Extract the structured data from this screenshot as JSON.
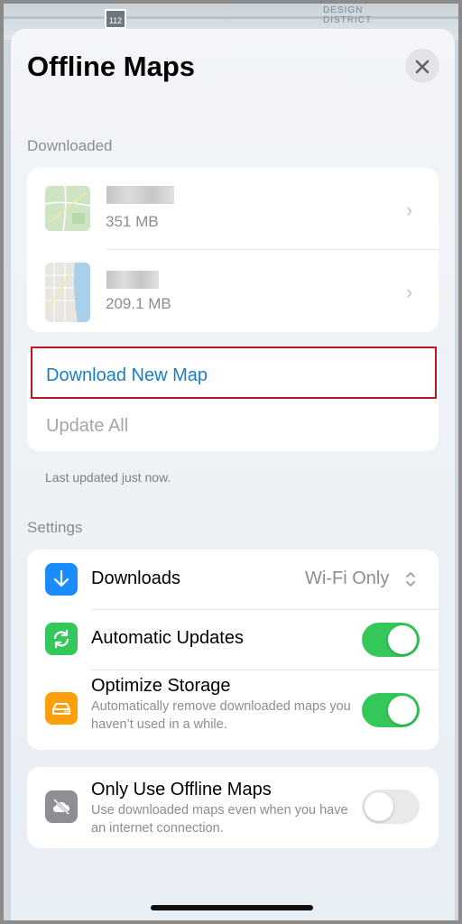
{
  "header": {
    "title": "Offline Maps",
    "close_icon": "close-icon"
  },
  "background_map": {
    "route_number": "112",
    "district_label": "DESIGN\nDISTRICT"
  },
  "downloaded": {
    "section_label": "Downloaded",
    "maps": [
      {
        "name_redacted": true,
        "size": "351 MB"
      },
      {
        "name_redacted": true,
        "size": "209.1 MB"
      }
    ]
  },
  "actions": {
    "download_new_map": "Download New Map",
    "update_all": "Update All"
  },
  "last_updated_note": "Last updated just now.",
  "settings": {
    "section_label": "Settings",
    "downloads": {
      "label": "Downloads",
      "value": "Wi-Fi Only"
    },
    "automatic_updates": {
      "label": "Automatic Updates",
      "enabled": true
    },
    "optimize_storage": {
      "label": "Optimize Storage",
      "description": "Automatically remove downloaded maps you haven’t used in a while.",
      "enabled": true
    },
    "only_offline": {
      "label": "Only Use Offline Maps",
      "description": "Use downloaded maps even when you have an internet connection.",
      "enabled": false
    }
  },
  "colors": {
    "accent_blue": "#1a7fc2",
    "toggle_on": "#34c759",
    "downloads_icon_bg": "#1a8cff",
    "updates_icon_bg": "#34c759",
    "storage_icon_bg": "#ff9f0a",
    "offline_icon_bg": "#8e8e93",
    "highlight_border": "#c0161e"
  }
}
